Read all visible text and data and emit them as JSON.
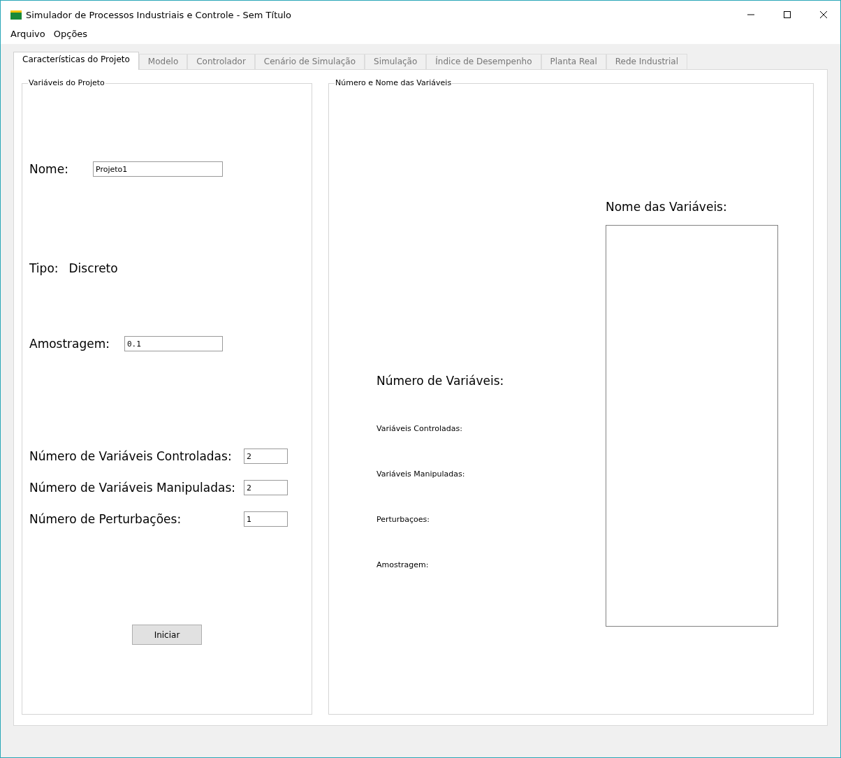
{
  "window": {
    "title": "Simulador de Processos Industriais e Controle - Sem Título"
  },
  "menu": [
    "Arquivo",
    "Opções"
  ],
  "tabs": [
    {
      "label": "Características do Projeto",
      "selected": true
    },
    {
      "label": "Modelo",
      "selected": false
    },
    {
      "label": "Controlador",
      "selected": false
    },
    {
      "label": "Cenário de Simulação",
      "selected": false
    },
    {
      "label": "Simulação",
      "selected": false
    },
    {
      "label": "Índice de Desempenho",
      "selected": false
    },
    {
      "label": "Planta Real",
      "selected": false
    },
    {
      "label": "Rede Industrial",
      "selected": false
    }
  ],
  "project_group": {
    "title": "Variáveis do Projeto",
    "name": {
      "label": "Nome:",
      "value": "Projeto1"
    },
    "type": {
      "label": "Tipo:",
      "value": "Discreto"
    },
    "sampling": {
      "label": "Amostragem:",
      "value": "0.1"
    },
    "counts": [
      {
        "label": "Número de Variáveis Controladas:",
        "value": "2"
      },
      {
        "label": "Número de Variáveis Manipuladas:",
        "value": "2"
      },
      {
        "label": "Número de Perturbações:",
        "value": "1"
      }
    ],
    "start_button": "Iniciar"
  },
  "variables_group": {
    "title": "Número e Nome das Variáveis",
    "count_heading": "Número de Variáveis:",
    "count_labels": [
      "Variáveis Controladas:",
      "Variáveis Manipuladas:",
      "Perturbaçoes:",
      "Amostragem:"
    ],
    "names_heading": "Nome das Variáveis:"
  }
}
